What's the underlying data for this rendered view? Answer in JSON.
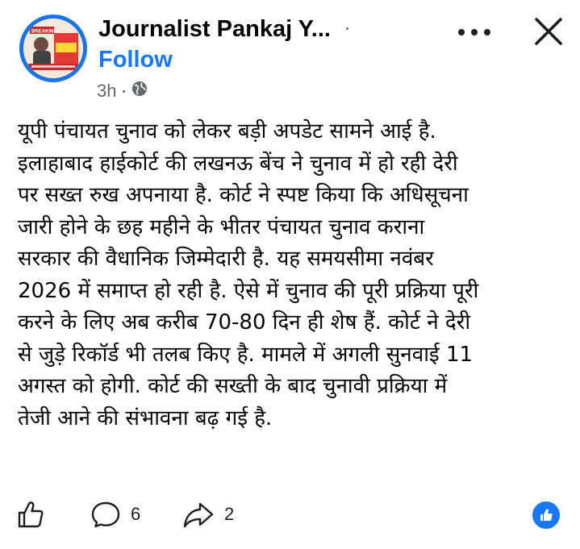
{
  "post": {
    "author": "Journalist Pankaj Y...",
    "follow_label": "Follow",
    "time": "3h",
    "audience_icon": "globe-icon",
    "lines": [
      "यूपी पंचायत चुनाव को लेकर बड़ी अपडेट सामने आई है.",
      "इलाहाबाद हाईकोर्ट की लखनऊ बेंच ने चुनाव में हो रही देरी",
      "पर सख्त रुख अपनाया है. कोर्ट ने स्पष्ट किया कि अधिसूचना",
      "जारी होने के छह महीने के भीतर पंचायत चुनाव कराना",
      "सरकार की वैधानिक जिम्मेदारी है. यह समयसीमा नवंबर",
      "2026 में समाप्त हो रही है. ऐसे में चुनाव की पूरी प्रक्रिया पूरी",
      "करने के लिए अब करीब 70-80 दिन ही शेष हैं. कोर्ट ने देरी",
      "से जुड़े रिकॉर्ड भी तलब किए है. मामले में अगली सुनवाई 11",
      "अगस्त को होगी. कोर्ट की सख्ती के बाद चुनावी प्रक्रिया में",
      "तेजी आने की संभावना बढ़ गई है."
    ]
  },
  "avatar_text": {
    "badge": "BREAKING"
  },
  "footer": {
    "like_icon": "thumbs-up-icon",
    "comment_icon": "comment-icon",
    "comment_count": "6",
    "share_icon": "share-icon",
    "share_count": "2",
    "reaction_icon": "like-reaction-icon"
  },
  "colors": {
    "accent": "#1877f2",
    "avatar_ring": "#1a73e8",
    "meta_gray": "#65676b",
    "text": "#050505"
  }
}
